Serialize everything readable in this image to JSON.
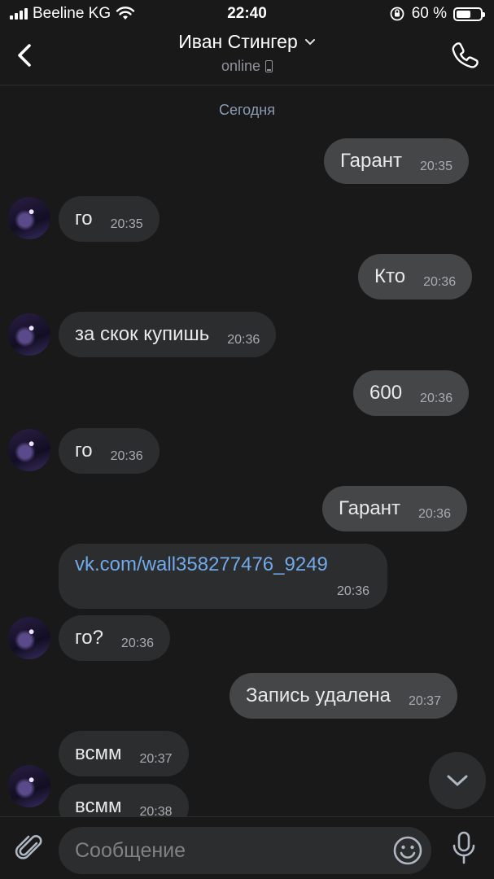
{
  "status_bar": {
    "carrier": "Beeline KG",
    "time": "22:40",
    "battery": "60 %",
    "battery_level": 0.6
  },
  "header": {
    "contact_name": "Иван Стингер",
    "status": "online",
    "icons": [
      "back-chevron-icon",
      "chevron-down-icon",
      "mobile-icon",
      "phone-call-icon"
    ]
  },
  "chat": {
    "date_separator": "Сегодня",
    "messages": [
      {
        "direction": "out",
        "text": "Гарант",
        "time": "20:35"
      },
      {
        "direction": "in",
        "text": "го",
        "time": "20:35"
      },
      {
        "direction": "out",
        "text": "Кто",
        "time": "20:36"
      },
      {
        "direction": "in",
        "text": "за скок купишь",
        "time": "20:36"
      },
      {
        "direction": "out",
        "text": "600",
        "time": "20:36"
      },
      {
        "direction": "in",
        "text": "го",
        "time": "20:36"
      },
      {
        "direction": "out",
        "text": "Гарант",
        "time": "20:36"
      },
      {
        "direction": "in",
        "text": "vk.com/wall358277476_9249",
        "time": "20:36"
      },
      {
        "direction": "in",
        "text": "го?",
        "time": "20:36"
      },
      {
        "direction": "out",
        "text": "Запись удалена",
        "time": "20:37"
      },
      {
        "direction": "in",
        "text": "всмм",
        "time": "20:37"
      },
      {
        "direction": "in",
        "text": "всмм",
        "time": "20:38"
      }
    ]
  },
  "composer": {
    "placeholder": "Сообщение",
    "icons": [
      "paperclip-icon",
      "smile-icon",
      "microphone-icon",
      "scroll-down-icon"
    ]
  },
  "colors": {
    "background": "#19191a",
    "incoming_bubble": "#2c2d2e",
    "outgoing_bubble": "#454647",
    "link": "#71aaeb"
  }
}
